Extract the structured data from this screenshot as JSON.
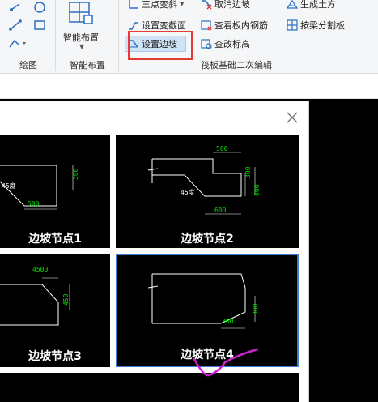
{
  "ribbon": {
    "groups": {
      "draw": "绘图",
      "smart_layout": "智能布置",
      "raft_edit": "筏板基础二次编辑"
    },
    "buttons": {
      "smart_layout": "智能布置",
      "three_point_slope": "三点变斜",
      "set_variable_section": "设置变截面",
      "set_slope_edge": "设置边坡",
      "cancel_slope_edge": "取消边坡",
      "view_slab_rebar": "查看板内钢筋",
      "view_change_elevation": "查改标高",
      "generate_earthwork": "生成土方",
      "split_by_beam": "按梁分割板"
    }
  },
  "dialog": {
    "cards": [
      {
        "label": "边坡节点1",
        "dims": [
          "300",
          "500"
        ],
        "angle": "45度"
      },
      {
        "label": "边坡节点2",
        "dims": [
          "500",
          "300",
          "600",
          "600"
        ],
        "angle": "45度"
      },
      {
        "label": "边坡节点3",
        "dims": [
          "4500",
          "450"
        ]
      },
      {
        "label": "边坡节点4",
        "dims": [
          "300",
          "300"
        ]
      }
    ]
  },
  "colors": {
    "accent": "#3b7fd0",
    "highlight": "#e53935",
    "annotation": "#d020d0",
    "dim_text": "#00e000"
  }
}
